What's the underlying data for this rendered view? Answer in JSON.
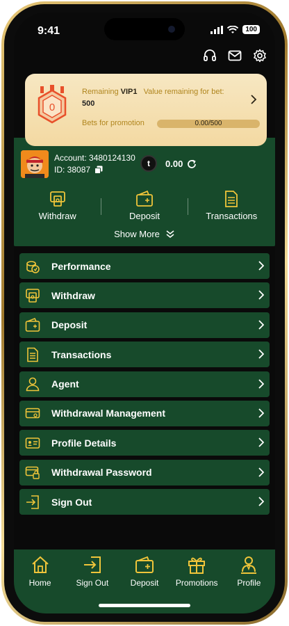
{
  "status": {
    "time": "9:41",
    "battery": "100"
  },
  "colors": {
    "green": "#174a2b",
    "gold": "#f0c53a",
    "vip_card": "#f5e0b3"
  },
  "header_icons": [
    "headset-icon",
    "mail-icon",
    "gear-icon"
  ],
  "vip": {
    "remaining_label": "Remaining",
    "level": "VIP1",
    "value_label": "Value remaining for bet:",
    "amount": "500",
    "promo_label": "Bets for promotion",
    "progress_text": "0.00/500",
    "progress_fraction": 0,
    "badge_level": "0"
  },
  "account": {
    "account_text": "Account: 3480124130",
    "id_text": "ID: 38087",
    "coin_symbol": "t",
    "balance": "0.00"
  },
  "quick_actions": [
    {
      "label": "Withdraw",
      "icon": "atm-icon"
    },
    {
      "label": "Deposit",
      "icon": "wallet-icon"
    },
    {
      "label": "Transactions",
      "icon": "document-icon"
    }
  ],
  "show_more": "Show More",
  "menu": [
    {
      "label": "Performance",
      "icon": "coins-icon"
    },
    {
      "label": "Withdraw",
      "icon": "atm-icon"
    },
    {
      "label": "Deposit",
      "icon": "wallet-icon"
    },
    {
      "label": "Transactions",
      "icon": "document-icon"
    },
    {
      "label": "Agent",
      "icon": "person-icon"
    },
    {
      "label": "Withdrawal Management",
      "icon": "card-icon"
    },
    {
      "label": "Profile Details",
      "icon": "id-card-icon"
    },
    {
      "label": "Withdrawal Password",
      "icon": "card-lock-icon"
    },
    {
      "label": "Sign Out",
      "icon": "sign-out-icon"
    }
  ],
  "bottom_nav": [
    {
      "label": "Home",
      "icon": "home-icon"
    },
    {
      "label": "Sign Out",
      "icon": "sign-out-icon"
    },
    {
      "label": "Deposit",
      "icon": "wallet-icon"
    },
    {
      "label": "Promotions",
      "icon": "gift-icon"
    },
    {
      "label": "Profile",
      "icon": "profile-icon"
    }
  ]
}
